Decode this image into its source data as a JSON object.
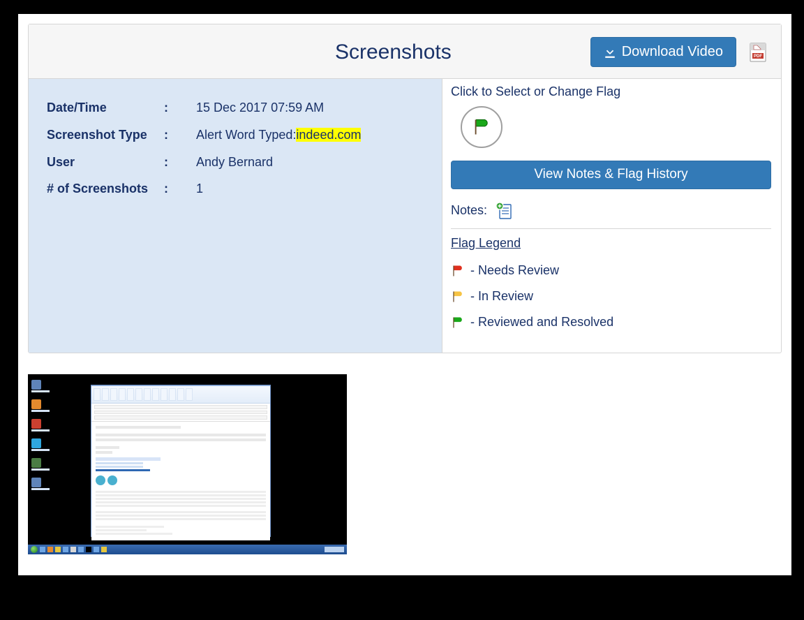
{
  "header": {
    "title": "Screenshots",
    "download_video_label": "Download Video"
  },
  "meta": {
    "date_label": "Date/Time",
    "date_value": "15 Dec 2017 07:59 AM",
    "type_label": "Screenshot Type",
    "type_prefix": "Alert Word Typed:",
    "type_highlight": "indeed.com",
    "user_label": "User",
    "user_value": "Andy Bernard",
    "count_label": "# of Screenshots",
    "count_value": "1"
  },
  "right": {
    "select_flag_label": "Click to Select or Change Flag",
    "current_flag_color": "#1aa81a",
    "view_notes_label": "View Notes & Flag History",
    "notes_label": "Notes:",
    "legend_title": "Flag Legend",
    "legend": [
      {
        "color": "#e0301e",
        "text": " - Needs Review"
      },
      {
        "color": "#f6c344",
        "text": " - In Review"
      },
      {
        "color": "#1aa81a",
        "text": " - Reviewed and Resolved"
      }
    ]
  }
}
